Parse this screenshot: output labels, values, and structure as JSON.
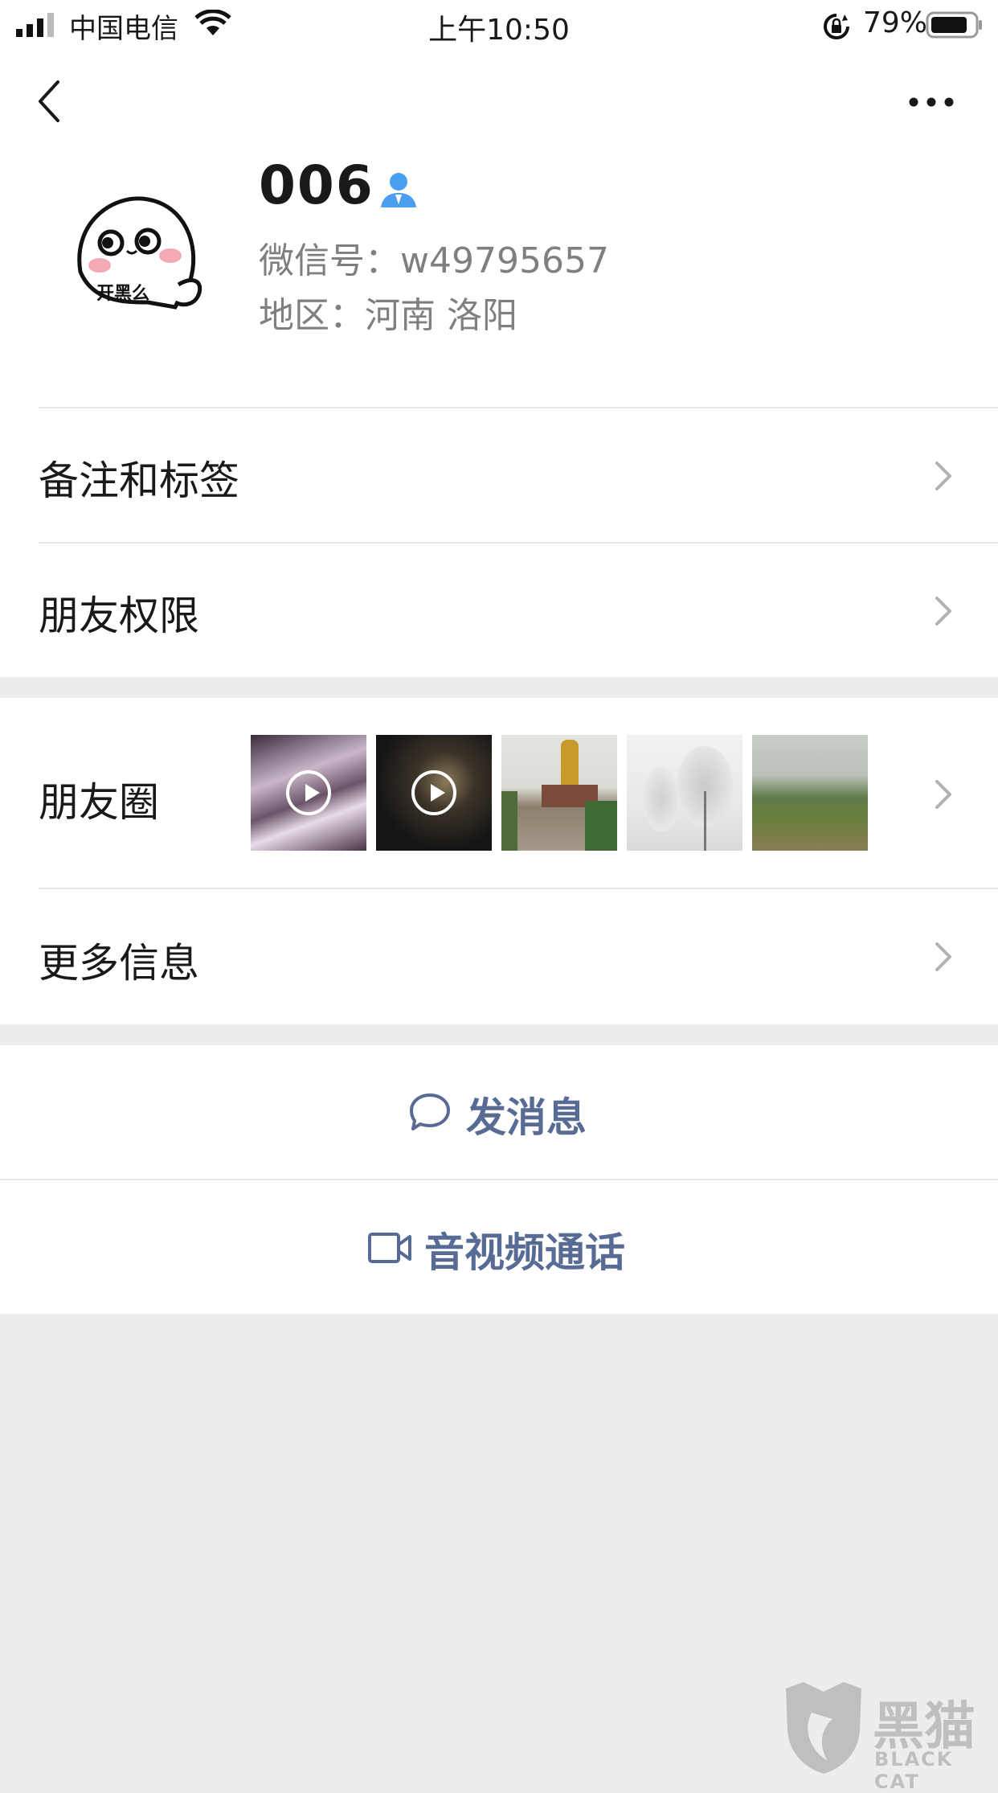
{
  "status_bar": {
    "carrier": "中国电信",
    "time": "上午10:50",
    "battery_percent": "79%"
  },
  "header": {
    "back_icon": "chevron-left-icon",
    "more_icon": "ellipsis-icon"
  },
  "profile": {
    "name": "006",
    "avatar_caption": "开黑么",
    "wechat_id": "微信号：w49795657",
    "region": "地区：河南 洛阳"
  },
  "menu": {
    "remarks": "备注和标签",
    "permissions": "朋友权限",
    "moments": "朋友圈",
    "more_info": "更多信息"
  },
  "actions": {
    "message": "发消息",
    "call": "音视频通话"
  },
  "colors": {
    "link": "#576b95",
    "bg": "#ededed",
    "accent_blue": "#4a9ff0"
  },
  "watermark": {
    "brand": "黑猫",
    "brand_en": "BLACK CAT"
  }
}
